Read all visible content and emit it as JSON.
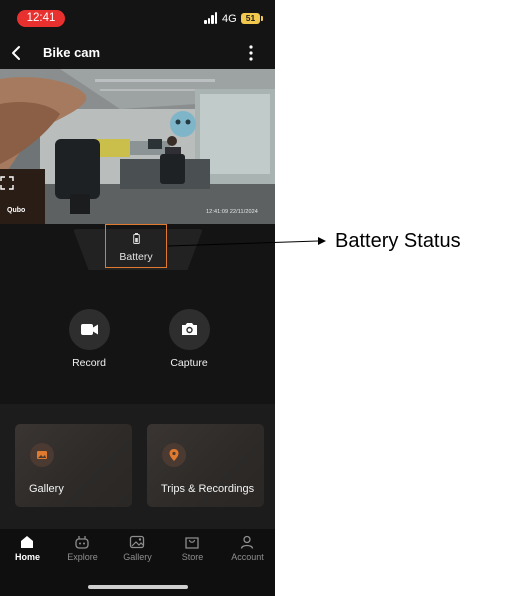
{
  "status_bar": {
    "time": "12:41",
    "network": "4G",
    "battery": "51"
  },
  "header": {
    "title": "Bike cam"
  },
  "preview": {
    "watermark": "Qubo",
    "timestamp": "12:41:09 22/11/2024"
  },
  "battery_button": {
    "label": "Battery"
  },
  "annotation": {
    "text": "Battery Status"
  },
  "actions": {
    "record_label": "Record",
    "capture_label": "Capture"
  },
  "tiles": {
    "gallery_label": "Gallery",
    "trips_label": "Trips & Recordings"
  },
  "nav": {
    "items": [
      {
        "label": "Home",
        "icon": "home-icon"
      },
      {
        "label": "Explore",
        "icon": "robot-icon"
      },
      {
        "label": "Gallery",
        "icon": "gallery-icon"
      },
      {
        "label": "Store",
        "icon": "store-icon"
      },
      {
        "label": "Account",
        "icon": "account-icon"
      }
    ],
    "active": "Home"
  },
  "colors": {
    "accent": "#e07a2e",
    "time_pill": "#e8302f",
    "battery_badge": "#f2c94c"
  }
}
